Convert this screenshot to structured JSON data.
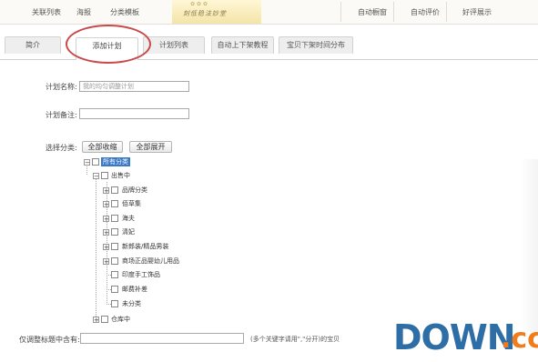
{
  "topnav": {
    "items": [
      "关联列表",
      "海报",
      "分类模板",
      "自动橱窗",
      "自动评价",
      "好评展示"
    ],
    "banner_text": "刻低稳法妙堂"
  },
  "tabs": [
    {
      "label": "简介",
      "active": false
    },
    {
      "label": "添加计划",
      "active": true
    },
    {
      "label": "计划列表",
      "active": false
    },
    {
      "label": "自动上下架教程",
      "active": false
    },
    {
      "label": "宝贝下架时间分布",
      "active": false
    }
  ],
  "form": {
    "plan_name_label": "计划名称:",
    "plan_name_value": "我的均匀调整计划",
    "plan_note_label": "计划备注:",
    "plan_note_value": "",
    "category_label": "选择分类:",
    "collapse_all": "全部收缩",
    "expand_all": "全部展开",
    "keyword_label": "仅调整标题中含有:",
    "keyword_value": "",
    "keyword_hint": "(多个关键字请用\",\"分开)的宝贝"
  },
  "tree": {
    "root": "所有分类",
    "on_sale": "出售中",
    "categories": [
      "品牌分类",
      "佰草集",
      "海夫",
      "清妃",
      "新郎装/精品男装",
      "商场正品婴幼儿用品",
      "印度手工饰品",
      "邮费补差",
      "未分类"
    ],
    "in_stock": "仓库中"
  },
  "watermark": {
    "main": "DOWN",
    "suffix": ".cc"
  }
}
